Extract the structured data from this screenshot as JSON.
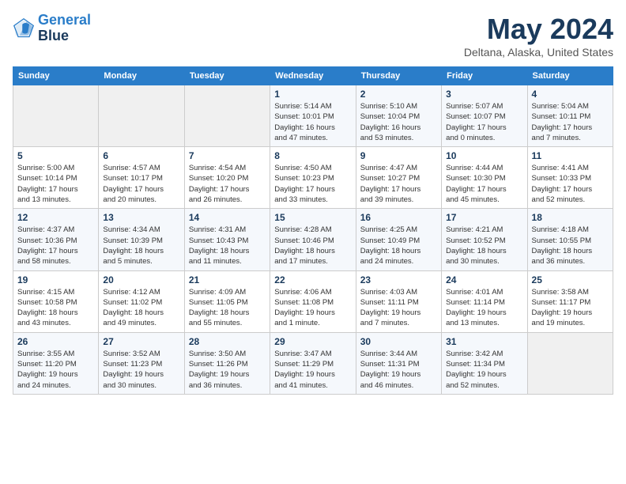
{
  "header": {
    "logo_line1": "General",
    "logo_line2": "Blue",
    "title": "May 2024",
    "location": "Deltana, Alaska, United States"
  },
  "days_of_week": [
    "Sunday",
    "Monday",
    "Tuesday",
    "Wednesday",
    "Thursday",
    "Friday",
    "Saturday"
  ],
  "weeks": [
    [
      {
        "num": "",
        "data": ""
      },
      {
        "num": "",
        "data": ""
      },
      {
        "num": "",
        "data": ""
      },
      {
        "num": "1",
        "data": "Sunrise: 5:14 AM\nSunset: 10:01 PM\nDaylight: 16 hours\nand 47 minutes."
      },
      {
        "num": "2",
        "data": "Sunrise: 5:10 AM\nSunset: 10:04 PM\nDaylight: 16 hours\nand 53 minutes."
      },
      {
        "num": "3",
        "data": "Sunrise: 5:07 AM\nSunset: 10:07 PM\nDaylight: 17 hours\nand 0 minutes."
      },
      {
        "num": "4",
        "data": "Sunrise: 5:04 AM\nSunset: 10:11 PM\nDaylight: 17 hours\nand 7 minutes."
      }
    ],
    [
      {
        "num": "5",
        "data": "Sunrise: 5:00 AM\nSunset: 10:14 PM\nDaylight: 17 hours\nand 13 minutes."
      },
      {
        "num": "6",
        "data": "Sunrise: 4:57 AM\nSunset: 10:17 PM\nDaylight: 17 hours\nand 20 minutes."
      },
      {
        "num": "7",
        "data": "Sunrise: 4:54 AM\nSunset: 10:20 PM\nDaylight: 17 hours\nand 26 minutes."
      },
      {
        "num": "8",
        "data": "Sunrise: 4:50 AM\nSunset: 10:23 PM\nDaylight: 17 hours\nand 33 minutes."
      },
      {
        "num": "9",
        "data": "Sunrise: 4:47 AM\nSunset: 10:27 PM\nDaylight: 17 hours\nand 39 minutes."
      },
      {
        "num": "10",
        "data": "Sunrise: 4:44 AM\nSunset: 10:30 PM\nDaylight: 17 hours\nand 45 minutes."
      },
      {
        "num": "11",
        "data": "Sunrise: 4:41 AM\nSunset: 10:33 PM\nDaylight: 17 hours\nand 52 minutes."
      }
    ],
    [
      {
        "num": "12",
        "data": "Sunrise: 4:37 AM\nSunset: 10:36 PM\nDaylight: 17 hours\nand 58 minutes."
      },
      {
        "num": "13",
        "data": "Sunrise: 4:34 AM\nSunset: 10:39 PM\nDaylight: 18 hours\nand 5 minutes."
      },
      {
        "num": "14",
        "data": "Sunrise: 4:31 AM\nSunset: 10:43 PM\nDaylight: 18 hours\nand 11 minutes."
      },
      {
        "num": "15",
        "data": "Sunrise: 4:28 AM\nSunset: 10:46 PM\nDaylight: 18 hours\nand 17 minutes."
      },
      {
        "num": "16",
        "data": "Sunrise: 4:25 AM\nSunset: 10:49 PM\nDaylight: 18 hours\nand 24 minutes."
      },
      {
        "num": "17",
        "data": "Sunrise: 4:21 AM\nSunset: 10:52 PM\nDaylight: 18 hours\nand 30 minutes."
      },
      {
        "num": "18",
        "data": "Sunrise: 4:18 AM\nSunset: 10:55 PM\nDaylight: 18 hours\nand 36 minutes."
      }
    ],
    [
      {
        "num": "19",
        "data": "Sunrise: 4:15 AM\nSunset: 10:58 PM\nDaylight: 18 hours\nand 43 minutes."
      },
      {
        "num": "20",
        "data": "Sunrise: 4:12 AM\nSunset: 11:02 PM\nDaylight: 18 hours\nand 49 minutes."
      },
      {
        "num": "21",
        "data": "Sunrise: 4:09 AM\nSunset: 11:05 PM\nDaylight: 18 hours\nand 55 minutes."
      },
      {
        "num": "22",
        "data": "Sunrise: 4:06 AM\nSunset: 11:08 PM\nDaylight: 19 hours\nand 1 minute."
      },
      {
        "num": "23",
        "data": "Sunrise: 4:03 AM\nSunset: 11:11 PM\nDaylight: 19 hours\nand 7 minutes."
      },
      {
        "num": "24",
        "data": "Sunrise: 4:01 AM\nSunset: 11:14 PM\nDaylight: 19 hours\nand 13 minutes."
      },
      {
        "num": "25",
        "data": "Sunrise: 3:58 AM\nSunset: 11:17 PM\nDaylight: 19 hours\nand 19 minutes."
      }
    ],
    [
      {
        "num": "26",
        "data": "Sunrise: 3:55 AM\nSunset: 11:20 PM\nDaylight: 19 hours\nand 24 minutes."
      },
      {
        "num": "27",
        "data": "Sunrise: 3:52 AM\nSunset: 11:23 PM\nDaylight: 19 hours\nand 30 minutes."
      },
      {
        "num": "28",
        "data": "Sunrise: 3:50 AM\nSunset: 11:26 PM\nDaylight: 19 hours\nand 36 minutes."
      },
      {
        "num": "29",
        "data": "Sunrise: 3:47 AM\nSunset: 11:29 PM\nDaylight: 19 hours\nand 41 minutes."
      },
      {
        "num": "30",
        "data": "Sunrise: 3:44 AM\nSunset: 11:31 PM\nDaylight: 19 hours\nand 46 minutes."
      },
      {
        "num": "31",
        "data": "Sunrise: 3:42 AM\nSunset: 11:34 PM\nDaylight: 19 hours\nand 52 minutes."
      },
      {
        "num": "",
        "data": ""
      }
    ]
  ]
}
